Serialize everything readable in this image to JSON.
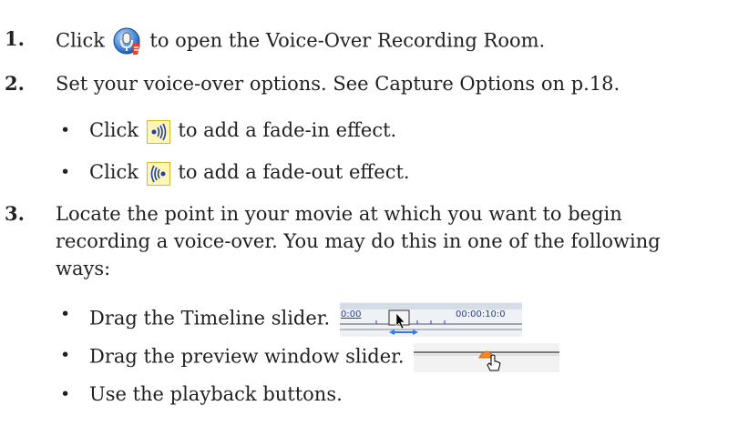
{
  "steps": [
    {
      "number": "1.",
      "before": "Click",
      "icon": "voice-over-microphone-icon",
      "after": "to open the Voice-Over Recording Room."
    },
    {
      "number": "2.",
      "text": "Set your voice-over options. See Capture Options on p.18.",
      "bullets": [
        {
          "before": "Click",
          "icon": "fade-in-icon",
          "after": "to add a fade-in effect."
        },
        {
          "before": "Click",
          "icon": "fade-out-icon",
          "after": "to add a fade-out effect."
        }
      ]
    },
    {
      "number": "3.",
      "lines": [
        "Locate the point in your movie at which you want to begin",
        "recording a voice-over. You may do this in one of the following",
        "ways:"
      ],
      "bullets": [
        {
          "text": "Drag the Timeline slider.",
          "image": "timeline-slider-icon",
          "timeline_start": "0:00",
          "timeline_end": "00:00:10:0"
        },
        {
          "text": "Drag the preview window slider.",
          "image": "preview-slider-icon"
        },
        {
          "text": "Use the playback buttons."
        }
      ]
    }
  ]
}
